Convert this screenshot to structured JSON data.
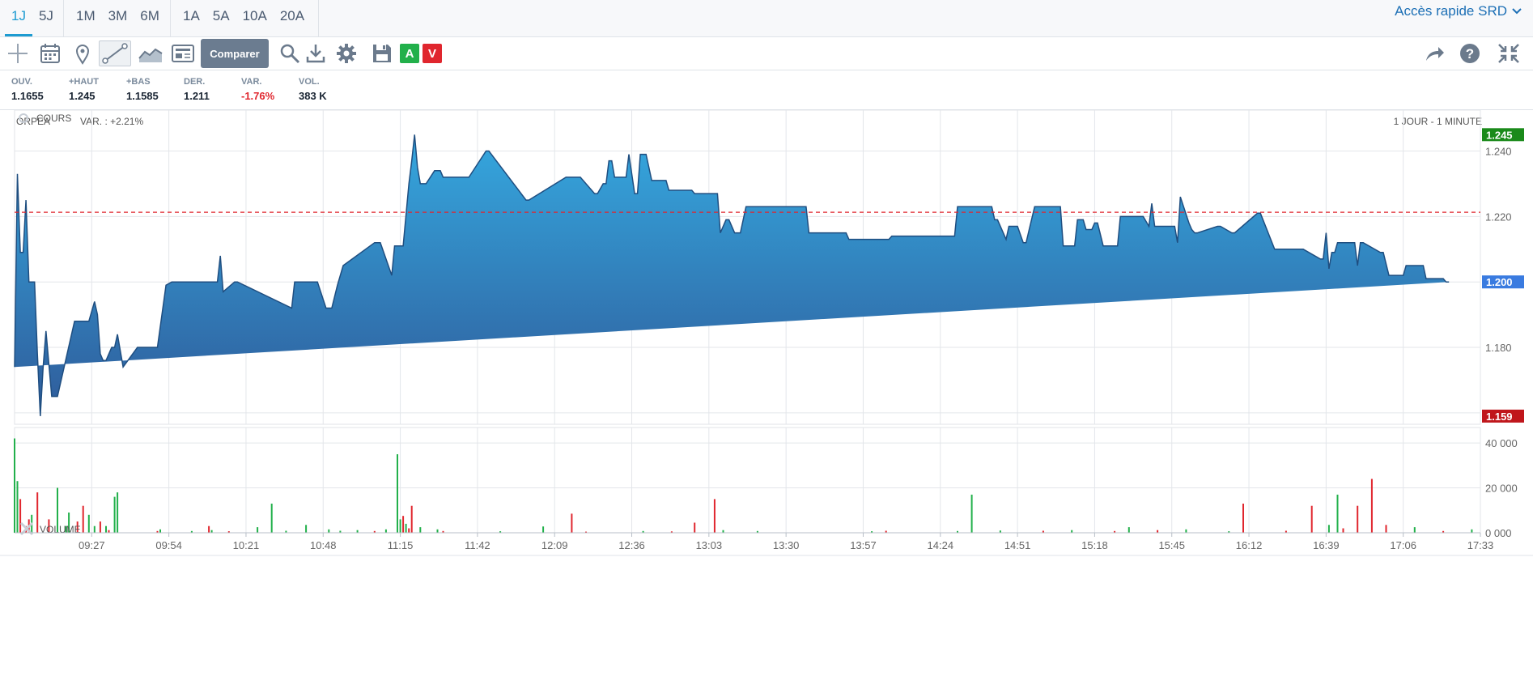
{
  "periods": {
    "groups": [
      [
        "1J",
        "5J"
      ],
      [
        "1M",
        "3M",
        "6M"
      ],
      [
        "1A",
        "5A",
        "10A",
        "20A"
      ]
    ],
    "active": "1J"
  },
  "quick_access": "Accès rapide SRD",
  "toolbar": {
    "compare_label": "Comparer",
    "badge_a": "A",
    "badge_v": "V",
    "icons": [
      "crosshair-icon",
      "calendar-icon",
      "pin-icon",
      "line-draw-icon",
      "area-chart-icon",
      "news-icon",
      "search-icon",
      "download-icon",
      "gear-icon",
      "save-icon",
      "share-icon",
      "help-icon",
      "collapse-icon"
    ]
  },
  "stats": [
    {
      "label": "OUV.",
      "value": "1.1655",
      "negative": false
    },
    {
      "label": "+HAUT",
      "value": "1.245",
      "negative": false
    },
    {
      "label": "+BAS",
      "value": "1.1585",
      "negative": false
    },
    {
      "label": "DER.",
      "value": "1.211",
      "negative": false
    },
    {
      "label": "VAR.",
      "value": "-1.76%",
      "negative": true
    },
    {
      "label": "VOL.",
      "value": "383 K",
      "negative": false
    }
  ],
  "chart_header": {
    "name": "ORPEA",
    "var": "VAR. : +2.21%",
    "interval": "1 JOUR - 1 MINUTE"
  },
  "colors": {
    "area_top": "#35a8df",
    "area_bottom": "#2f5b9a",
    "line": "#1f4e80",
    "up": "#22b04b",
    "down": "#e0262e",
    "ref": "#e0262e",
    "high_badge": "#1a8a1a",
    "last_badge": "#3a7be0",
    "low_badge": "#c0161b"
  },
  "chart_data": [
    {
      "type": "area",
      "panel_label": "COURS",
      "x_ticks": [
        "09:27",
        "09:54",
        "10:21",
        "10:48",
        "11:15",
        "11:42",
        "12:09",
        "12:36",
        "13:03",
        "13:30",
        "13:57",
        "14:24",
        "14:51",
        "15:18",
        "15:45",
        "16:12",
        "16:39",
        "17:06",
        "17:33"
      ],
      "y_ticks": [
        "1.160",
        "1.180",
        "1.200",
        "1.220",
        "1.240"
      ],
      "ylim": [
        1.1565,
        1.2525
      ],
      "reference_line": 1.2213,
      "badges": {
        "high": "1.245",
        "last": "1.200",
        "low": "1.159"
      },
      "x": [
        "09:00",
        "09:01",
        "09:02",
        "09:03",
        "09:04",
        "09:05",
        "09:07",
        "09:08",
        "09:09",
        "09:10",
        "09:11",
        "09:13",
        "09:15",
        "09:21",
        "09:24",
        "09:26",
        "09:28",
        "09:29",
        "09:30",
        "09:31",
        "09:32",
        "09:34",
        "09:35",
        "09:36",
        "09:38",
        "09:43",
        "09:44",
        "09:47",
        "09:50",
        "09:53",
        "09:55",
        "10:10",
        "10:11",
        "10:12",
        "10:13",
        "10:17",
        "10:18",
        "10:37",
        "10:38",
        "10:45",
        "10:46",
        "10:49",
        "10:51",
        "10:53",
        "10:55",
        "11:06",
        "11:07",
        "11:08",
        "11:12",
        "11:13",
        "11:16",
        "11:18",
        "11:19",
        "11:20",
        "11:21",
        "11:22",
        "11:24",
        "11:27",
        "11:29",
        "11:30",
        "11:39",
        "11:45",
        "11:46",
        "11:59",
        "12:00",
        "12:13",
        "12:14",
        "12:18",
        "12:23",
        "12:24",
        "12:26",
        "12:27",
        "12:28",
        "12:29",
        "12:30",
        "12:34",
        "12:35",
        "12:37",
        "12:38",
        "12:39",
        "12:41",
        "12:43",
        "12:48",
        "12:49",
        "12:57",
        "12:58",
        "13:06",
        "13:07",
        "13:09",
        "13:10",
        "13:12",
        "13:14",
        "13:16",
        "13:17",
        "13:18",
        "13:37",
        "13:38",
        "13:51",
        "13:52",
        "14:06",
        "14:07",
        "14:28",
        "14:29",
        "14:30",
        "14:37",
        "14:38",
        "14:42",
        "14:43",
        "14:44",
        "14:47",
        "14:48",
        "14:50",
        "14:51",
        "14:53",
        "14:54",
        "14:57",
        "15:06",
        "15:07",
        "15:11",
        "15:12",
        "15:14",
        "15:15",
        "15:17",
        "15:18",
        "15:19",
        "15:21",
        "15:26",
        "15:27",
        "15:35",
        "15:37",
        "15:38",
        "15:39",
        "15:46",
        "15:47",
        "15:48",
        "15:51",
        "15:52",
        "15:53",
        "15:54",
        "16:01",
        "16:02",
        "16:06",
        "16:07",
        "16:15",
        "16:16",
        "16:21",
        "16:22",
        "16:30",
        "16:31",
        "16:37",
        "16:38",
        "16:39",
        "16:40",
        "16:41",
        "16:42",
        "16:43",
        "16:48",
        "16:49",
        "16:50",
        "16:51",
        "16:52",
        "16:58",
        "16:59",
        "17:01",
        "17:02",
        "17:06",
        "17:07",
        "17:08",
        "17:13",
        "17:14",
        "17:20",
        "17:21",
        "17:22",
        "17:25",
        "17:26",
        "17:27",
        "17:30"
      ],
      "values": [
        1.174,
        1.233,
        1.209,
        1.209,
        1.225,
        1.2,
        1.2,
        1.178,
        1.159,
        1.174,
        1.185,
        1.165,
        1.165,
        1.188,
        1.188,
        1.188,
        1.194,
        1.19,
        1.178,
        1.176,
        1.176,
        1.18,
        1.18,
        1.184,
        1.174,
        1.18,
        1.18,
        1.18,
        1.18,
        1.199,
        1.2,
        1.2,
        1.2,
        1.208,
        1.197,
        1.2,
        1.2,
        1.192,
        1.2,
        1.2,
        1.2,
        1.192,
        1.192,
        1.199,
        1.205,
        1.212,
        1.212,
        1.212,
        1.202,
        1.211,
        1.211,
        1.23,
        1.237,
        1.245,
        1.235,
        1.23,
        1.23,
        1.234,
        1.234,
        1.232,
        1.232,
        1.24,
        1.24,
        1.225,
        1.225,
        1.232,
        1.232,
        1.232,
        1.227,
        1.227,
        1.23,
        1.23,
        1.237,
        1.237,
        1.232,
        1.232,
        1.239,
        1.227,
        1.227,
        1.239,
        1.239,
        1.231,
        1.231,
        1.228,
        1.228,
        1.227,
        1.227,
        1.215,
        1.219,
        1.219,
        1.215,
        1.215,
        1.223,
        1.223,
        1.223,
        1.223,
        1.215,
        1.215,
        1.213,
        1.213,
        1.214,
        1.214,
        1.214,
        1.223,
        1.223,
        1.223,
        1.223,
        1.219,
        1.219,
        1.213,
        1.217,
        1.217,
        1.217,
        1.212,
        1.212,
        1.223,
        1.223,
        1.211,
        1.211,
        1.219,
        1.219,
        1.216,
        1.216,
        1.218,
        1.218,
        1.211,
        1.211,
        1.22,
        1.22,
        1.217,
        1.224,
        1.217,
        1.217,
        1.212,
        1.226,
        1.218,
        1.216,
        1.215,
        1.215,
        1.217,
        1.217,
        1.215,
        1.215,
        1.221,
        1.221,
        1.21,
        1.21,
        1.21,
        1.21,
        1.207,
        1.207,
        1.215,
        1.204,
        1.209,
        1.209,
        1.212,
        1.212,
        1.212,
        1.205,
        1.212,
        1.212,
        1.209,
        1.209,
        1.202,
        1.202,
        1.202,
        1.205,
        1.205,
        1.205,
        1.201,
        1.201,
        1.2,
        1.2
      ]
    },
    {
      "type": "bar",
      "panel_label": "VOLUME",
      "y_ticks": [
        "0 000",
        "20 000",
        "40 000"
      ],
      "ylim": [
        0,
        44000
      ],
      "x": [
        "09:00",
        "09:01",
        "09:02",
        "09:04",
        "09:05",
        "09:06",
        "09:08",
        "09:12",
        "09:15",
        "09:18",
        "09:19",
        "09:22",
        "09:24",
        "09:26",
        "09:28",
        "09:30",
        "09:32",
        "09:33",
        "09:35",
        "09:36",
        "09:50",
        "09:51",
        "10:02",
        "10:08",
        "10:09",
        "10:15",
        "10:25",
        "10:30",
        "10:35",
        "10:42",
        "10:50",
        "10:54",
        "11:00",
        "11:06",
        "11:10",
        "11:14",
        "11:15",
        "11:16",
        "11:17",
        "11:18",
        "11:19",
        "11:22",
        "11:28",
        "11:30",
        "11:50",
        "12:05",
        "12:15",
        "12:20",
        "12:40",
        "12:50",
        "12:58",
        "13:05",
        "13:08",
        "13:20",
        "14:00",
        "14:05",
        "14:30",
        "14:35",
        "14:45",
        "15:00",
        "15:10",
        "15:25",
        "15:30",
        "15:40",
        "15:50",
        "16:05",
        "16:10",
        "16:25",
        "16:34",
        "16:40",
        "16:43",
        "16:45",
        "16:50",
        "16:55",
        "17:00",
        "17:10",
        "17:20",
        "17:30"
      ],
      "values": [
        42000,
        23000,
        15000,
        3000,
        6000,
        8000,
        18000,
        6000,
        20000,
        3000,
        9000,
        5000,
        12000,
        8000,
        3000,
        5000,
        3000,
        1200,
        16000,
        18000,
        800,
        1500,
        800,
        3000,
        1200,
        700,
        2500,
        13000,
        900,
        3500,
        1500,
        900,
        1200,
        800,
        1500,
        35000,
        6000,
        7500,
        4000,
        2000,
        12000,
        2500,
        1500,
        800,
        700,
        2800,
        8500,
        500,
        800,
        600,
        4500,
        15000,
        1200,
        800,
        700,
        900,
        800,
        17000,
        1000,
        900,
        1200,
        800,
        2500,
        1200,
        1500,
        700,
        13000,
        900,
        12000,
        3500,
        17000,
        2000,
        12000,
        24000,
        3500,
        2500,
        800,
        1500
      ],
      "colors": [
        "up",
        "up",
        "down",
        "down",
        "down",
        "up",
        "down",
        "down",
        "up",
        "up",
        "up",
        "down",
        "down",
        "up",
        "up",
        "down",
        "up",
        "down",
        "up",
        "up",
        "down",
        "up",
        "up",
        "down",
        "up",
        "down",
        "up",
        "up",
        "up",
        "up",
        "up",
        "up",
        "up",
        "down",
        "up",
        "up",
        "up",
        "down",
        "up",
        "down",
        "down",
        "up",
        "up",
        "down",
        "up",
        "up",
        "down",
        "down",
        "up",
        "down",
        "down",
        "down",
        "up",
        "up",
        "up",
        "down",
        "up",
        "up",
        "up",
        "down",
        "up",
        "down",
        "up",
        "down",
        "up",
        "up",
        "down",
        "down",
        "down",
        "up",
        "up",
        "down",
        "down",
        "down",
        "down",
        "up",
        "down",
        "up"
      ]
    }
  ]
}
